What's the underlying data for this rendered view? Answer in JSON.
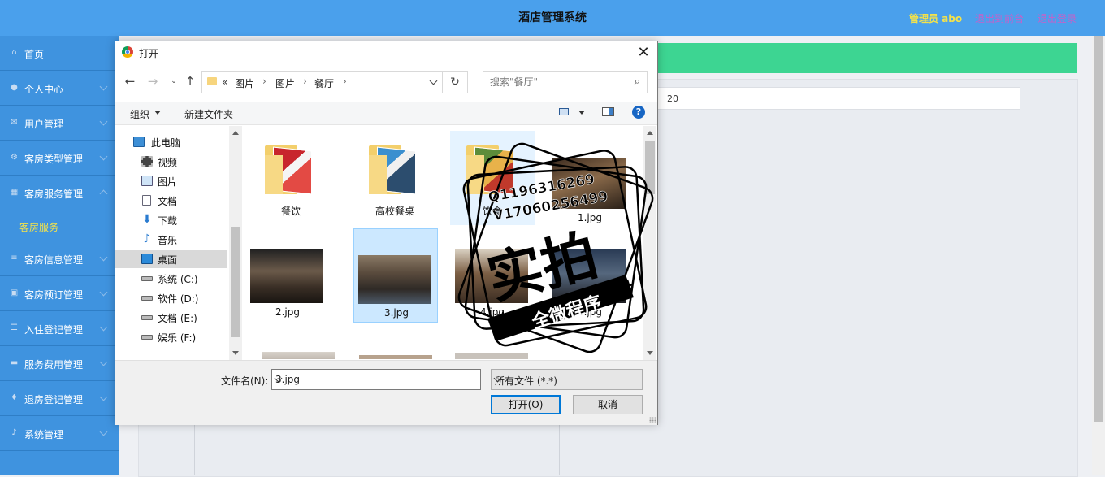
{
  "header": {
    "title": "酒店管理系统",
    "admin": "管理员 abo",
    "to_front": "退出到前台",
    "logout": "退出登录"
  },
  "sidebar": {
    "items": [
      {
        "label": "首页",
        "icon": "home-icon"
      },
      {
        "label": "个人中心",
        "icon": "user-icon"
      },
      {
        "label": "用户管理",
        "icon": "mail-icon"
      },
      {
        "label": "客房类型管理",
        "icon": "gear-icon"
      },
      {
        "label": "客房服务管理",
        "icon": "grid-icon"
      },
      {
        "label": "客房信息管理",
        "icon": "list-icon"
      },
      {
        "label": "客房预订管理",
        "icon": "calendar-icon"
      },
      {
        "label": "入住登记管理",
        "icon": "sliders-icon"
      },
      {
        "label": "服务费用管理",
        "icon": "monitor-icon"
      },
      {
        "label": "退房登记管理",
        "icon": "location-icon"
      },
      {
        "label": "系统管理",
        "icon": "mic-icon"
      }
    ],
    "sub_active": "客房服务"
  },
  "content": {
    "field_value": "20"
  },
  "dialog": {
    "title": "打开",
    "breadcrumb": [
      "«",
      "图片",
      "图片",
      "餐厅"
    ],
    "search_placeholder": "搜索\"餐厅\"",
    "toolbar": {
      "organize": "组织",
      "new_folder": "新建文件夹",
      "help": "?"
    },
    "tree": [
      {
        "label": "此电脑",
        "icon": "computer-icon"
      },
      {
        "label": "视频",
        "icon": "video-icon"
      },
      {
        "label": "图片",
        "icon": "image-icon"
      },
      {
        "label": "文档",
        "icon": "document-icon"
      },
      {
        "label": "下载",
        "icon": "download-icon"
      },
      {
        "label": "音乐",
        "icon": "music-icon"
      },
      {
        "label": "桌面",
        "icon": "desktop-icon"
      },
      {
        "label": "系统 (C:)",
        "icon": "drive-icon"
      },
      {
        "label": "软件 (D:)",
        "icon": "drive-icon"
      },
      {
        "label": "文档 (E:)",
        "icon": "drive-icon"
      },
      {
        "label": "娱乐 (F:)",
        "icon": "drive-icon"
      }
    ],
    "files": [
      {
        "name": "餐饮",
        "kind": "folder"
      },
      {
        "name": "高校餐桌",
        "kind": "folder"
      },
      {
        "name": "饮食",
        "kind": "folder"
      },
      {
        "name": "1.jpg",
        "kind": "image"
      },
      {
        "name": "2.jpg",
        "kind": "image"
      },
      {
        "name": "3.jpg",
        "kind": "image"
      },
      {
        "name": "4.jpg",
        "kind": "image"
      },
      {
        "name": "5.jpg",
        "kind": "image"
      }
    ],
    "filename_label": "文件名(N):",
    "filename_value": "3.jpg",
    "filetype_value": "所有文件 (*.*)",
    "open_button": "打开(O)",
    "cancel_button": "取消"
  },
  "watermark": {
    "line1": "Q1196316269",
    "line2": "V17060256499",
    "main": "实拍",
    "banner": "全微程序"
  },
  "colors": {
    "header_bg": "#4aa0ec",
    "sidebar_bg": "#3f93df",
    "green_bar": "#3dd592",
    "accent_yellow": "#f3e24b",
    "link_purple": "#c561c9"
  }
}
